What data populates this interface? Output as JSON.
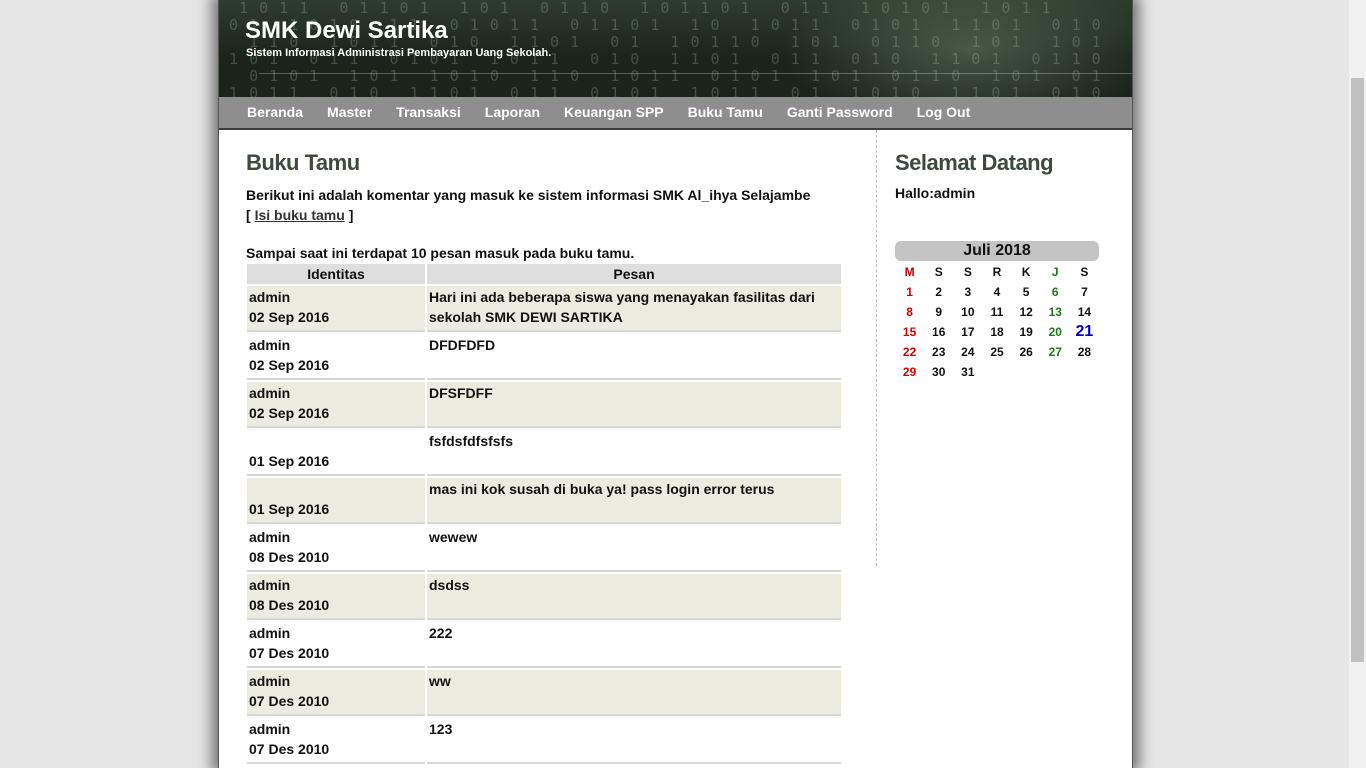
{
  "site": {
    "title": "SMK Dewi Sartika",
    "tagline": "Sistem Informasi Administrasi Pembayaran Uang Sekolah."
  },
  "nav": [
    {
      "label": "Beranda"
    },
    {
      "label": "Master"
    },
    {
      "label": "Transaksi"
    },
    {
      "label": "Laporan"
    },
    {
      "label": "Keuangan SPP"
    },
    {
      "label": "Buku Tamu"
    },
    {
      "label": "Ganti Password"
    },
    {
      "label": "Log Out"
    }
  ],
  "main": {
    "heading": "Buku Tamu",
    "intro": "Berikut ini adalah komentar yang masuk ke sistem informasi SMK Al_ihya Selajambe",
    "bracket_open": "[",
    "link_label": "Isi buku tamu",
    "bracket_close": "]",
    "count_text": "Sampai saat ini terdapat 10 pesan masuk pada buku tamu.",
    "columns": [
      "Identitas",
      "Pesan"
    ],
    "rows": [
      {
        "name": "admin",
        "date": "02 Sep 2016",
        "message": "Hari ini ada beberapa siswa yang menayakan fasilitas dari sekolah SMK DEWI SARTIKA"
      },
      {
        "name": "admin",
        "date": "02 Sep 2016",
        "message": "DFDFDFD"
      },
      {
        "name": "admin",
        "date": "02 Sep 2016",
        "message": "DFSFDFF"
      },
      {
        "name": "",
        "date": "01 Sep 2016",
        "message": "fsfdsfdfsfsfs"
      },
      {
        "name": "",
        "date": "01 Sep 2016",
        "message": "mas ini kok susah di buka ya! pass login error terus"
      },
      {
        "name": "admin",
        "date": "08 Des 2010",
        "message": "wewew"
      },
      {
        "name": "admin",
        "date": "08 Des 2010",
        "message": "dsdss"
      },
      {
        "name": "admin",
        "date": "07 Des 2010",
        "message": "222"
      },
      {
        "name": "admin",
        "date": "07 Des 2010",
        "message": "ww"
      },
      {
        "name": "admin",
        "date": "07 Des 2010",
        "message": "123"
      }
    ]
  },
  "sidebar": {
    "heading": "Selamat Datang",
    "greeting": "Hallo:admin"
  },
  "calendar": {
    "month_label": "Juli 2018",
    "weekdays": [
      "M",
      "S",
      "S",
      "R",
      "K",
      "J",
      "S"
    ],
    "first_weekday_index": 0,
    "days_in_month": 31,
    "today": 21,
    "colors": {
      "sunday": "#d10000",
      "friday": "#1c7a1c",
      "today": "#0000cc"
    }
  },
  "colors": {
    "navbar": "#8e8e8e",
    "heading": "#3d4a3d",
    "row_alt": "#ecebe0",
    "page_bg": "#e6e6e6"
  }
}
